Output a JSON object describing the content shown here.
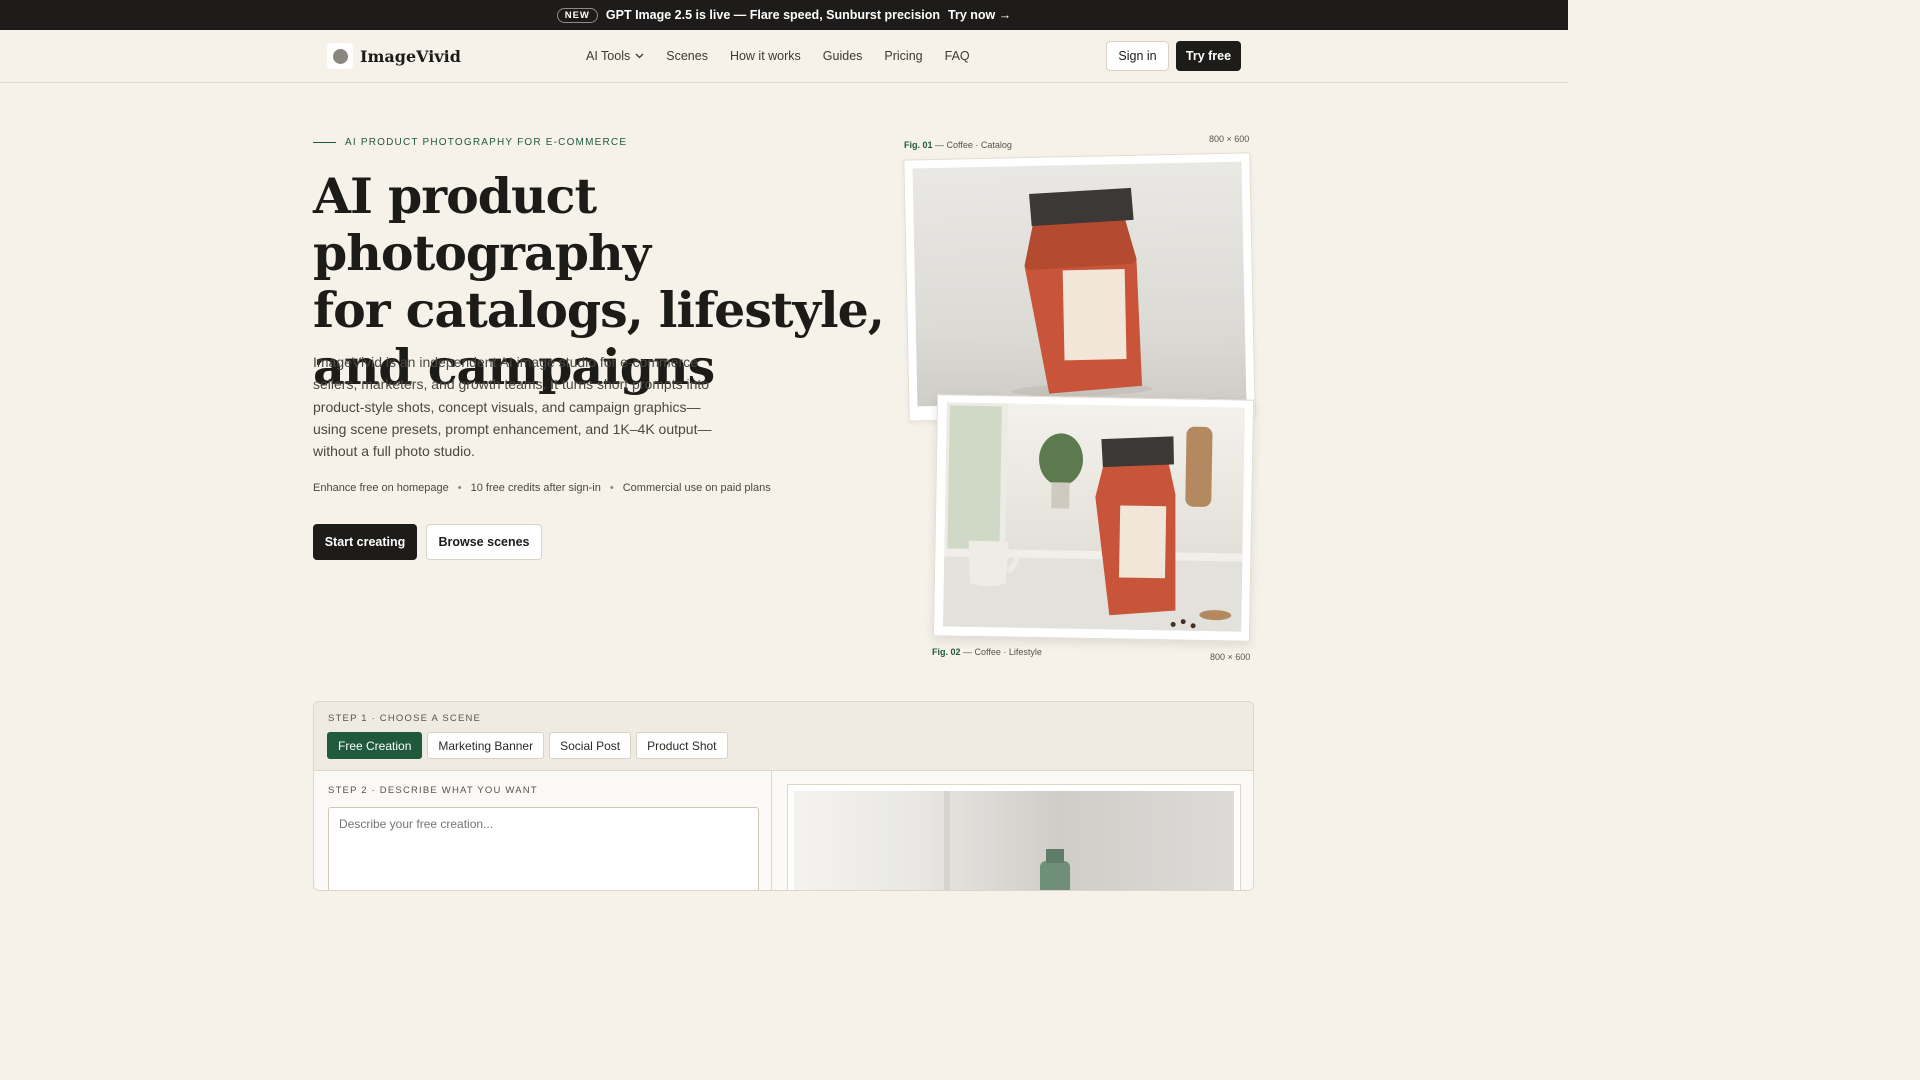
{
  "announcement": {
    "badge": "NEW",
    "message": "GPT Image 2.5 is live — Flare speed, Sunburst precision",
    "cta": "Try now →"
  },
  "nav": {
    "brand": "ImageVivid",
    "links": [
      "AI Tools",
      "Scenes",
      "How it works",
      "Guides",
      "Pricing",
      "FAQ"
    ],
    "sign_in": "Sign in",
    "try_free": "Try free"
  },
  "hero": {
    "eyebrow": "AI PRODUCT PHOTOGRAPHY FOR E-COMMERCE",
    "title_line1": "AI product photography",
    "title_line2": "for catalogs, lifestyle,",
    "title_line3": "and campaigns",
    "description": "ImageVivid is an independent AI image studio for e-commerce sellers, marketers, and growth teams. It turns short prompts into product-style shots, concept visuals, and campaign graphics—using scene presets, prompt enhancement, and 1K–4K output—without a full photo studio.",
    "perks": [
      "Enhance free on homepage",
      "10 free credits after sign-in",
      "Commercial use on paid plans"
    ],
    "primary_cta": "Start creating",
    "secondary_cta": "Browse scenes"
  },
  "figures": [
    {
      "label": "Fig. 01",
      "caption": "— Coffee · Catalog",
      "size": "800 × 600"
    },
    {
      "label": "Fig. 02",
      "caption": "— Coffee · Lifestyle",
      "size": "800 × 600"
    }
  ],
  "generator": {
    "step1": "STEP 1 · CHOOSE A SCENE",
    "scenes": [
      "Free Creation",
      "Marketing Banner",
      "Social Post",
      "Product Shot"
    ],
    "active_scene": "Free Creation",
    "step2": "STEP 2 · DESCRIBE WHAT YOU WANT",
    "prompt_placeholder": "Describe your free creation...",
    "prompt_value": ""
  },
  "colors": {
    "background": "#f6f2ea",
    "dark": "#1d1c1a",
    "accent_green": "#1f5a3d",
    "bag_orange": "#c8553a"
  }
}
